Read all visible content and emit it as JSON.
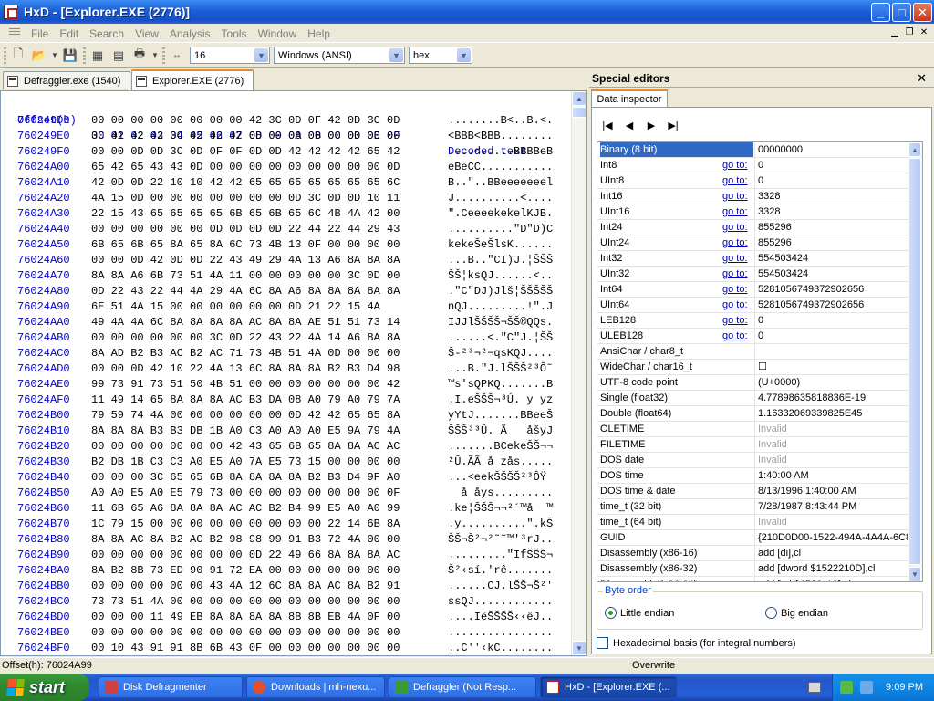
{
  "window": {
    "title": "HxD - [Explorer.EXE (2776)]",
    "controls": {
      "minimize": "_",
      "maximize": "□",
      "close": "✕"
    }
  },
  "menu": [
    "File",
    "Edit",
    "Search",
    "View",
    "Analysis",
    "Tools",
    "Window",
    "Help"
  ],
  "toolbar": {
    "bytes_per_row": "16",
    "charset": "Windows (ANSI)",
    "offset_base": "hex"
  },
  "tabs": [
    {
      "label": "Defraggler.exe (1540)",
      "active": false
    },
    {
      "label": "Explorer.EXE (2776)",
      "active": true
    }
  ],
  "hex": {
    "header": {
      "offset": "Offset(h)",
      "columns": "00 01 02 03 04 05 06 07 08 09 0A 0B 0C 0D 0E 0F",
      "decoded": "Decoded text"
    },
    "rows": [
      {
        "o": "760249D0",
        "b": "00 00 00 00 00 00 00 00 42 3C 0D 0F 42 0D 3C 0D",
        "d": "........B<..B.<."
      },
      {
        "o": "760249E0",
        "b": "3C 42 42 42 3C 42 42 42 0D 00 00 00 00 00 00 00",
        "d": "<BBB<BBB........"
      },
      {
        "o": "760249F0",
        "b": "00 00 0D 0D 3C 0D 0F 0F 0D 0D 42 42 42 42 65 42",
        "d": "....<.....BBBBeB"
      },
      {
        "o": "76024A00",
        "b": "65 42 65 43 43 0D 00 00 00 00 00 00 00 00 00 0D",
        "d": "eBeCC..........."
      },
      {
        "o": "76024A10",
        "b": "42 0D 0D 22 10 10 42 42 65 65 65 65 65 65 65 6C",
        "d": "B..\"..BBeeeeeeel"
      },
      {
        "o": "76024A20",
        "b": "4A 15 0D 00 00 00 00 00 00 00 0D 3C 0D 0D 10 11",
        "d": "J..........<...."
      },
      {
        "o": "76024A30",
        "b": "22 15 43 65 65 65 65 6B 65 6B 65 6C 4B 4A 42 00",
        "d": "\".CeeeekekelKJB."
      },
      {
        "o": "76024A40",
        "b": "00 00 00 00 00 00 0D 0D 0D 0D 22 44 22 44 29 43",
        "d": "..........\"D\"D)C"
      },
      {
        "o": "76024A50",
        "b": "6B 65 6B 65 8A 65 8A 6C 73 4B 13 0F 00 00 00 00",
        "d": "kekeŠeŠlsK......"
      },
      {
        "o": "76024A60",
        "b": "00 00 0D 42 0D 0D 22 43 49 29 4A 13 A6 8A 8A 8A",
        "d": "...B..\"CI)J.¦ŠŠŠ"
      },
      {
        "o": "76024A70",
        "b": "8A 8A A6 6B 73 51 4A 11 00 00 00 00 00 3C 0D 00",
        "d": "ŠŠ¦ksQJ......<.."
      },
      {
        "o": "76024A80",
        "b": "0D 22 43 22 44 4A 29 4A 6C 8A A6 8A 8A 8A 8A 8A",
        "d": ".\"C\"DJ)Jlš¦ŠŠŠŠŠ"
      },
      {
        "o": "76024A90",
        "b": "6E 51 4A 15 00 00 00 00 00 00 0D 21 22 15 4A",
        "d": "nQJ.........!\".J"
      },
      {
        "o": "76024AA0",
        "b": "49 4A 4A 6C 8A 8A 8A 8A AC 8A 8A AE 51 51 73 14",
        "d": "IJJlŠŠŠŠ¬ŠŠ®QQs."
      },
      {
        "o": "76024AB0",
        "b": "00 00 00 00 00 00 3C 0D 22 43 22 4A 14 A6 8A 8A",
        "d": "......<.\"C\"J.¦ŠŠ"
      },
      {
        "o": "76024AC0",
        "b": "8A AD B2 B3 AC B2 AC 71 73 4B 51 4A 0D 00 00 00",
        "d": "Š-²³¬²¬qsKQJ...."
      },
      {
        "o": "76024AD0",
        "b": "00 00 0D 42 10 22 4A 13 6C 8A 8A 8A B2 B3 D4 98",
        "d": "...B.\"J.lŠŠŠ²³Ô˜"
      },
      {
        "o": "76024AE0",
        "b": "99 73 91 73 51 50 4B 51 00 00 00 00 00 00 00 42",
        "d": "™s'sQPKQ.......B"
      },
      {
        "o": "76024AF0",
        "b": "11 49 14 65 8A 8A 8A AC B3 DA 08 A0 79 A0 79 7A",
        "d": ".I.eŠŠŠ¬³Ú. y yz"
      },
      {
        "o": "76024B00",
        "b": "79 59 74 4A 00 00 00 00 00 00 0D 42 42 65 65 8A",
        "d": "yYtJ.......BBeeŠ"
      },
      {
        "o": "76024B10",
        "b": "8A 8A 8A B3 B3 DB 1B A0 C3 A0 A0 A0 E5 9A 79 4A",
        "d": "ŠŠŠ³³Û. Ã   åšyJ"
      },
      {
        "o": "76024B20",
        "b": "00 00 00 00 00 00 00 42 43 65 6B 65 8A 8A AC AC",
        "d": ".......BCekeŠŠ¬¬"
      },
      {
        "o": "76024B30",
        "b": "B2 DB 1B C3 C3 A0 E5 A0 7A E5 73 15 00 00 00 00",
        "d": "²Û.ÃÃ å zås....."
      },
      {
        "o": "76024B40",
        "b": "00 00 00 3C 65 65 6B 8A 8A 8A 8A B2 B3 D4 9F A0",
        "d": "...<eekŠŠŠŠ²³ÔŸ "
      },
      {
        "o": "76024B50",
        "b": "A0 A0 E5 A0 E5 79 73 00 00 00 00 00 00 00 00 0F",
        "d": "  å åys........."
      },
      {
        "o": "76024B60",
        "b": "11 6B 65 A6 8A 8A 8A AC AC B2 B4 99 E5 A0 A0 99",
        "d": ".ke¦ŠŠŠ¬¬²´™å  ™"
      },
      {
        "o": "76024B70",
        "b": "1C 79 15 00 00 00 00 00 00 00 00 00 22 14 6B 8A",
        "d": ".y..........\".kŠ"
      },
      {
        "o": "76024B80",
        "b": "8A 8A AC 8A B2 AC B2 98 98 99 91 B3 72 4A 00 00",
        "d": "ŠŠ¬Š²¬²˜˜™'³rJ.."
      },
      {
        "o": "76024B90",
        "b": "00 00 00 00 00 00 00 00 0D 22 49 66 8A 8A 8A AC",
        "d": ".........\"IfŠŠŠ¬"
      },
      {
        "o": "76024BA0",
        "b": "8A B2 8B 73 ED 90 91 72 EA 00 00 00 00 00 00 00",
        "d": "Š²‹sí.'rê......."
      },
      {
        "o": "76024BB0",
        "b": "00 00 00 00 00 00 43 4A 12 6C 8A 8A AC 8A B2 91",
        "d": "......CJ.lŠŠ¬Š²'"
      },
      {
        "o": "76024BC0",
        "b": "73 73 51 4A 00 00 00 00 00 00 00 00 00 00 00 00",
        "d": "ssQJ............"
      },
      {
        "o": "76024BD0",
        "b": "00 00 00 11 49 EB 8A 8A 8A 8A 8B 8B EB 4A 0F 00",
        "d": "....IëŠŠŠŠ‹‹ëJ.."
      },
      {
        "o": "76024BE0",
        "b": "00 00 00 00 00 00 00 00 00 00 00 00 00 00 00 00",
        "d": "................"
      },
      {
        "o": "76024BF0",
        "b": "00 10 43 91 91 8B 6B 43 0F 00 00 00 00 00 00 00",
        "d": "..C''‹kC........"
      },
      {
        "o": "76024C00",
        "b": "00 00 00 00 00 00 00 00 00 00 00 00 00 00 00 00",
        "d": "................"
      },
      {
        "o": "76024C10",
        "b": "00 00 00 00 00 00 00 00 00 00 00 00 00 00 00 00",
        "d": "................"
      }
    ]
  },
  "special_editors": {
    "title": "Special editors",
    "tab": "Data inspector",
    "rows": [
      {
        "name": "Binary (8 bit)",
        "goto": "",
        "value": "00000000",
        "sel": true
      },
      {
        "name": "Int8",
        "goto": "go to:",
        "value": "0"
      },
      {
        "name": "UInt8",
        "goto": "go to:",
        "value": "0"
      },
      {
        "name": "Int16",
        "goto": "go to:",
        "value": "3328"
      },
      {
        "name": "UInt16",
        "goto": "go to:",
        "value": "3328"
      },
      {
        "name": "Int24",
        "goto": "go to:",
        "value": "855296"
      },
      {
        "name": "UInt24",
        "goto": "go to:",
        "value": "855296"
      },
      {
        "name": "Int32",
        "goto": "go to:",
        "value": "554503424"
      },
      {
        "name": "UInt32",
        "goto": "go to:",
        "value": "554503424"
      },
      {
        "name": "Int64",
        "goto": "go to:",
        "value": "5281056749372902656"
      },
      {
        "name": "UInt64",
        "goto": "go to:",
        "value": "5281056749372902656"
      },
      {
        "name": "LEB128",
        "goto": "go to:",
        "value": "0"
      },
      {
        "name": "ULEB128",
        "goto": "go to:",
        "value": "0"
      },
      {
        "name": "AnsiChar / char8_t",
        "goto": "",
        "value": ""
      },
      {
        "name": "WideChar / char16_t",
        "goto": "",
        "value": "☐"
      },
      {
        "name": "UTF-8 code point",
        "goto": "",
        "value": "   (U+0000)"
      },
      {
        "name": "Single (float32)",
        "goto": "",
        "value": "4.77898635818836E-19"
      },
      {
        "name": "Double (float64)",
        "goto": "",
        "value": "1.16332069339825E45"
      },
      {
        "name": "OLETIME",
        "goto": "",
        "value": "Invalid",
        "dis": true
      },
      {
        "name": "FILETIME",
        "goto": "",
        "value": "Invalid",
        "dis": true
      },
      {
        "name": "DOS date",
        "goto": "",
        "value": "Invalid",
        "dis": true
      },
      {
        "name": "DOS time",
        "goto": "",
        "value": "1:40:00 AM"
      },
      {
        "name": "DOS time & date",
        "goto": "",
        "value": "8/13/1996 1:40:00 AM"
      },
      {
        "name": "time_t (32 bit)",
        "goto": "",
        "value": "7/28/1987 8:43:44 PM"
      },
      {
        "name": "time_t (64 bit)",
        "goto": "",
        "value": "Invalid",
        "dis": true
      },
      {
        "name": "GUID",
        "goto": "",
        "value": "{210D0D00-1522-494A-4A4A-6C8"
      },
      {
        "name": "Disassembly (x86-16)",
        "goto": "",
        "value": "add [di],cl"
      },
      {
        "name": "Disassembly (x86-32)",
        "goto": "",
        "value": "add [dword $1522210D],cl"
      },
      {
        "name": "Disassembly (x86-64)",
        "goto": "",
        "value": "add [rel $1522112],cl"
      }
    ],
    "byte_order": {
      "label": "Byte order",
      "little": "Little endian",
      "big": "Big endian"
    },
    "hex_basis": "Hexadecimal basis (for integral numbers)"
  },
  "status": {
    "offset": "Offset(h): 76024A99",
    "mode": "Overwrite"
  },
  "taskbar": {
    "start": "start",
    "tasks": [
      {
        "label": "Disk Defragmenter",
        "color": "#d04040"
      },
      {
        "label": "Downloads | mh-nexu...",
        "color": "#e0502a"
      },
      {
        "label": "Defraggler (Not Resp...",
        "color": "#3a9a3a"
      },
      {
        "label": "HxD - [Explorer.EXE (...",
        "color": "#ffffff"
      }
    ],
    "clock": "9:09 PM"
  }
}
